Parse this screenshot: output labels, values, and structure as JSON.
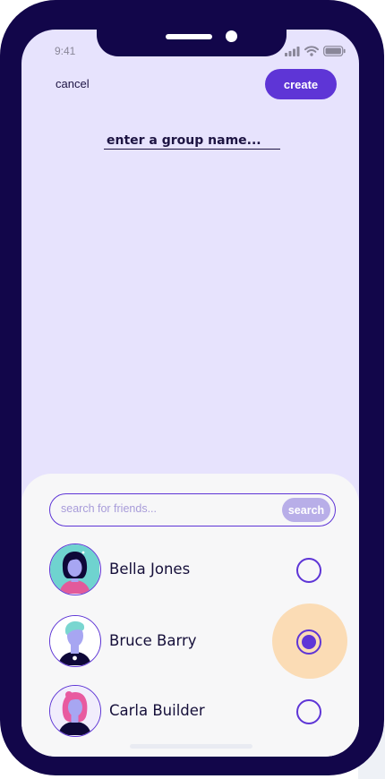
{
  "status_bar": {
    "time": "9:41",
    "icons": [
      "signal-icon",
      "wifi-icon",
      "battery-icon"
    ]
  },
  "header": {
    "cancel_label": "cancel",
    "create_label": "create"
  },
  "group_name": {
    "placeholder": "enter a group name..."
  },
  "search": {
    "placeholder": "search for friends...",
    "button_label": "search"
  },
  "friends": [
    {
      "name": "Bella Jones",
      "avatar": "avatar-bella",
      "selected": false
    },
    {
      "name": "Bruce Barry",
      "avatar": "avatar-bruce",
      "selected": true
    },
    {
      "name": "Carla Builder",
      "avatar": "avatar-carla",
      "selected": false
    }
  ],
  "colors": {
    "frame": "#12064a",
    "screen_background": "#e7e3fd",
    "accent": "#5e35d6",
    "sheet_background": "#f7f7f8",
    "selection_halo": "#fbdcb5",
    "search_button": "#b8aee8"
  }
}
